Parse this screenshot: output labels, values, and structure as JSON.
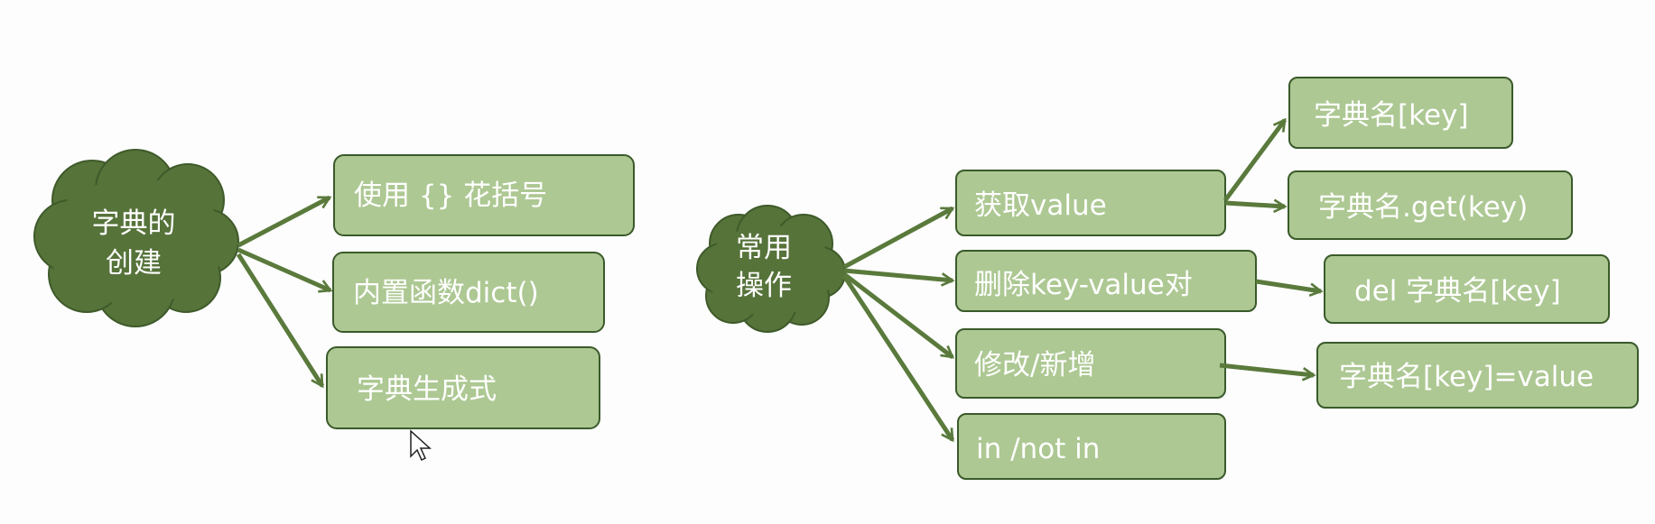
{
  "creation": {
    "cloud_line1": "字典的",
    "cloud_line2": "创建",
    "items": [
      "使用 {} 花括号",
      "内置函数dict()",
      "字典生成式"
    ]
  },
  "operations": {
    "cloud_line1": "常用",
    "cloud_line2": "操作",
    "get": "获取value",
    "get_ways": [
      "字典名[key]",
      "字典名.get(key)"
    ],
    "delete": "删除key-value对",
    "delete_way": "del 字典名[key]",
    "modify": "修改/新增",
    "modify_way": "字典名[key]=value",
    "membership": "in  /not in"
  },
  "colors": {
    "box_fill": "#adc893",
    "cloud_fill": "#56733a",
    "arrow": "#5a7a3c"
  },
  "icons": [
    "cloud-icon",
    "mouse-cursor-icon"
  ]
}
